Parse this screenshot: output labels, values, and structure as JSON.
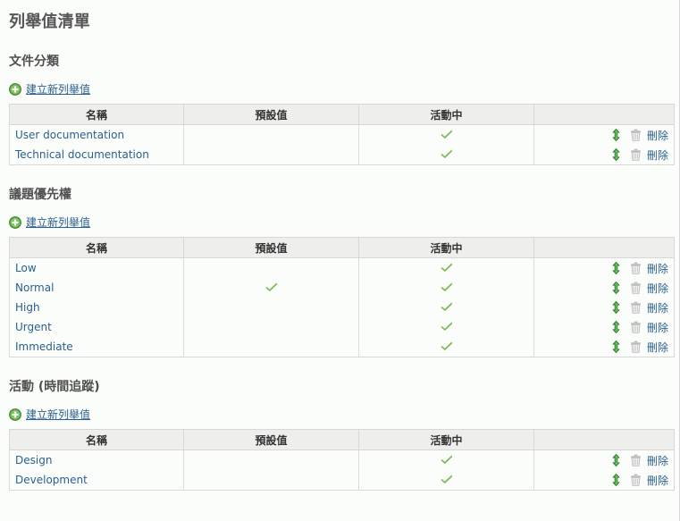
{
  "page": {
    "title": "列舉值清單"
  },
  "columns": {
    "name": "名稱",
    "default": "預設值",
    "active": "活動中",
    "actions": ""
  },
  "labels": {
    "new_enum": "建立新列舉值",
    "delete": "刪除",
    "plus_icon": "plus-circle-icon",
    "reorder_icon": "reorder-updown-icon",
    "trash_icon": "trash-icon",
    "check_icon": "check-icon"
  },
  "colors": {
    "link": "#2a5f8f",
    "check_green": "#67ae3f",
    "plus_green": "#54a14c",
    "header_bg": "#eeeeec",
    "row_odd_bg": "#f1f3f9",
    "row_even_bg": "#fbfdfa",
    "border": "#d7d7d7",
    "page_bg": "#fbfdfa"
  },
  "sections": [
    {
      "title": "文件分類",
      "rows": [
        {
          "name": "User documentation",
          "is_default": false,
          "is_active": true
        },
        {
          "name": "Technical documentation",
          "is_default": false,
          "is_active": true
        }
      ]
    },
    {
      "title": "議題優先權",
      "rows": [
        {
          "name": "Low",
          "is_default": false,
          "is_active": true
        },
        {
          "name": "Normal",
          "is_default": true,
          "is_active": true
        },
        {
          "name": "High",
          "is_default": false,
          "is_active": true
        },
        {
          "name": "Urgent",
          "is_default": false,
          "is_active": true
        },
        {
          "name": "Immediate",
          "is_default": false,
          "is_active": true
        }
      ]
    },
    {
      "title": "活動 (時間追蹤)",
      "rows": [
        {
          "name": "Design",
          "is_default": false,
          "is_active": true
        },
        {
          "name": "Development",
          "is_default": false,
          "is_active": true
        }
      ]
    }
  ]
}
